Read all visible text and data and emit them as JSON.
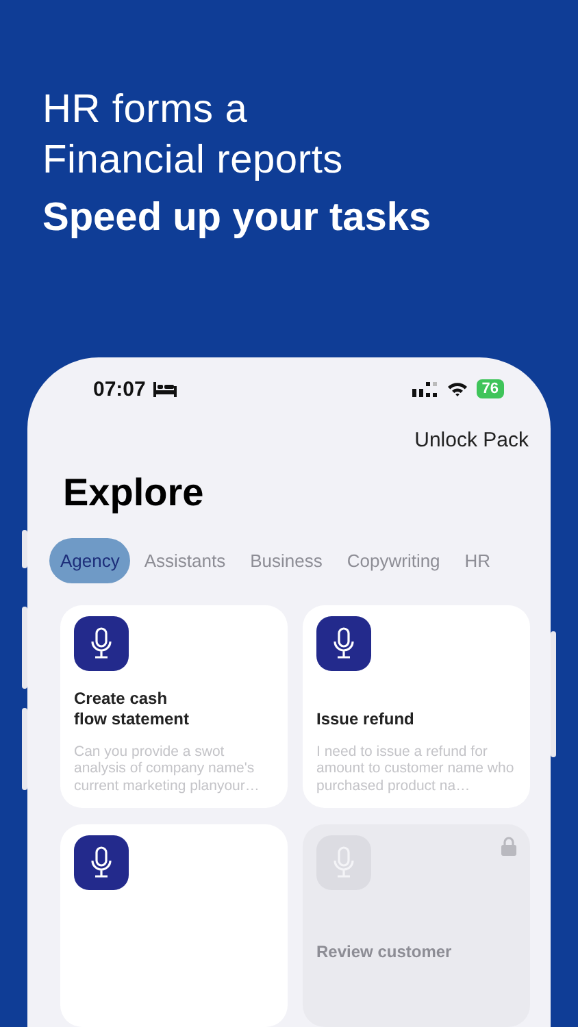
{
  "headline": {
    "lines": [
      "HR forms a",
      "Financial reports"
    ],
    "tagline": "Speed up your tasks"
  },
  "status_bar": {
    "time": "07:07",
    "battery": "76"
  },
  "unlock_button": "Unlock Pack",
  "title": "Explore",
  "tabs": [
    {
      "label": "Agency",
      "selected": true
    },
    {
      "label": "Assistants",
      "selected": false
    },
    {
      "label": "Business",
      "selected": false
    },
    {
      "label": "Copywriting",
      "selected": false
    },
    {
      "label": "HR",
      "selected": false
    }
  ],
  "cards": [
    {
      "title": "Create cash\nflow statement",
      "description": "Can you provide a swot analysis of company name's current marketing planyour…",
      "locked": false
    },
    {
      "title": "Issue refund",
      "description": "I need to issue a refund for amount to customer name who purchased product na…",
      "locked": false
    },
    {
      "locked": false
    },
    {
      "title": "Review customer",
      "locked": true
    }
  ]
}
